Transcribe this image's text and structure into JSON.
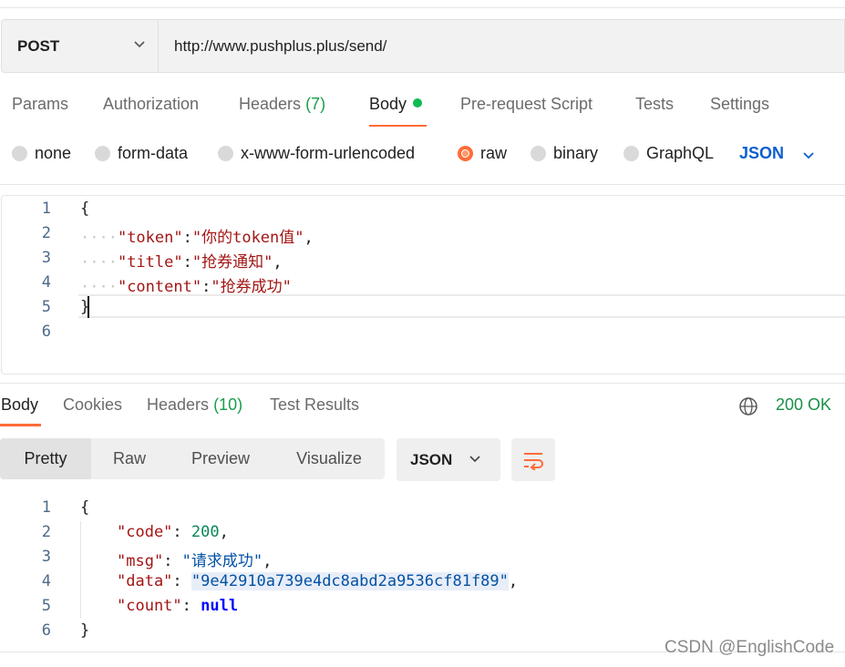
{
  "request": {
    "method": "POST",
    "url": "http://www.pushplus.plus/send/"
  },
  "request_tabs": {
    "params": "Params",
    "authorization": "Authorization",
    "headers": "Headers",
    "headers_count": "(7)",
    "body": "Body",
    "pre_request_script": "Pre-request Script",
    "tests": "Tests",
    "settings": "Settings"
  },
  "body_types": {
    "none": "none",
    "form_data": "form-data",
    "urlencoded": "x-www-form-urlencoded",
    "raw": "raw",
    "binary": "binary",
    "graphql": "GraphQL",
    "selected": "raw",
    "language": "JSON"
  },
  "request_body": {
    "line_numbers": [
      "1",
      "2",
      "3",
      "4",
      "5",
      "6"
    ],
    "open_brace": "{",
    "close_brace": "}",
    "indent_dots": "····",
    "fields": [
      {
        "key": "\"token\"",
        "sep": ":",
        "value": "\"你的token值\"",
        "trail": ","
      },
      {
        "key": "\"title\"",
        "sep": ":",
        "value": "\"抢券通知\"",
        "trail": ","
      },
      {
        "key": "\"content\"",
        "sep": ":",
        "value": "\"抢券成功\"",
        "trail": ""
      }
    ]
  },
  "response_tabs": {
    "body": "Body",
    "cookies": "Cookies",
    "headers": "Headers",
    "headers_count": "(10)",
    "test_results": "Test Results"
  },
  "response_status": "200 OK",
  "response_view": {
    "pretty": "Pretty",
    "raw": "Raw",
    "preview": "Preview",
    "visualize": "Visualize",
    "format": "JSON"
  },
  "response_body": {
    "line_numbers": [
      "1",
      "2",
      "3",
      "4",
      "5",
      "6"
    ],
    "open_brace": "{",
    "close_brace": "}",
    "code_key": "\"code\"",
    "code_value": "200",
    "msg_key": "\"msg\"",
    "msg_value": "\"请求成功\"",
    "data_key": "\"data\"",
    "data_value": "\"9e42910a739e4dc8abd2a9536cf81f89\"",
    "count_key": "\"count\"",
    "count_value": "null"
  },
  "watermark": "CSDN @EnglishCode",
  "colors": {
    "accent": "#ff6c37",
    "status_ok": "#1a8f48",
    "json_link": "#0b5fcf"
  }
}
